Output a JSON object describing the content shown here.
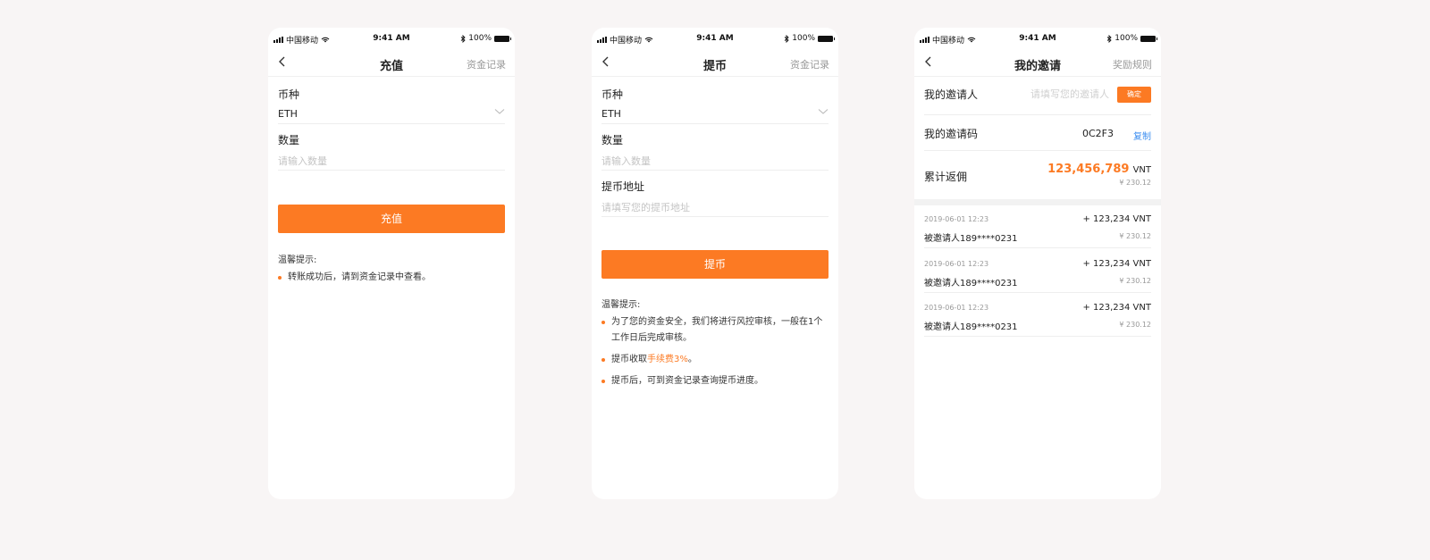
{
  "status_bar": {
    "carrier": "中国移动",
    "time": "9:41 AM",
    "battery": "100%"
  },
  "deposit": {
    "title": "充值",
    "right_link": "资金记录",
    "currency_label": "币种",
    "currency_value": "ETH",
    "amount_label": "数量",
    "amount_placeholder": "请输入数量",
    "button": "充值",
    "tips_title": "温馨提示:",
    "tips": [
      "转账成功后，请到资金记录中查看。"
    ]
  },
  "withdraw": {
    "title": "提币",
    "right_link": "资金记录",
    "currency_label": "币种",
    "currency_value": "ETH",
    "amount_label": "数量",
    "amount_placeholder": "请输入数量",
    "address_label": "提币地址",
    "address_placeholder": "请填写您的提币地址",
    "button": "提币",
    "tips_title": "温馨提示:",
    "tip1_line1": "为了您的资金安全，我们将进行风控审核，一般在1个",
    "tip1_line2": "工作日后完成审核。",
    "tip2_prefix": "提币收取",
    "tip2_highlight": "手续费3%",
    "tip2_suffix": "。",
    "tip3": "提币后，可到资金记录查询提币进度。"
  },
  "invite": {
    "title": "我的邀请",
    "right_link": "奖励规则",
    "inviter_label": "我的邀请人",
    "inviter_placeholder": "请填写您的邀请人",
    "confirm_button": "确定",
    "code_label": "我的邀请码",
    "code_value": "0C2F3",
    "copy_button": "复制",
    "total_label": "累计返佣",
    "total_value": "123,456,789",
    "total_unit": "VNT",
    "total_cny": "¥ 230.12",
    "records": [
      {
        "date": "2019-06-01 12:23",
        "amount": "+ 123,234 VNT",
        "invitee": "被邀请人189****0231",
        "cny": "¥ 230.12"
      },
      {
        "date": "2019-06-01 12:23",
        "amount": "+ 123,234 VNT",
        "invitee": "被邀请人189****0231",
        "cny": "¥ 230.12"
      },
      {
        "date": "2019-06-01 12:23",
        "amount": "+ 123,234 VNT",
        "invitee": "被邀请人189****0231",
        "cny": "¥ 230.12"
      }
    ]
  },
  "colors": {
    "accent": "#fc7a23",
    "link_blue": "#3c8ef0",
    "background": "#f8f5f5"
  }
}
